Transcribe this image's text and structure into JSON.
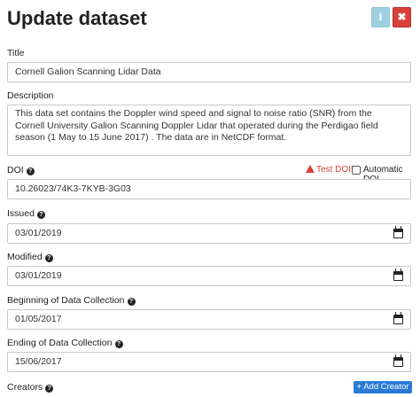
{
  "header": {
    "title": "Update dataset",
    "info_icon": "info-icon",
    "close_icon": "close-icon",
    "info_label": "i",
    "close_label": "✖"
  },
  "form": {
    "title": {
      "label": "Title",
      "value": "Cornell Galion Scanning Lidar Data"
    },
    "description": {
      "label": "Description",
      "value": "This data set contains the Doppler wind speed and signal to noise ratio (SNR) from the Cornell University Galion Scanning Doppler Lidar that operated during the Perdigao field season (1 May to 15 June 2017) . The data are in NetCDF format."
    },
    "doi": {
      "label": "DOI",
      "value": "10.26023/74K3-7KYB-3G03",
      "test_doi": "Test DOI!",
      "automatic_doi": "Automatic DOI",
      "automatic_checked": false
    },
    "issued": {
      "label": "Issued",
      "value": "03/01/2019"
    },
    "modified": {
      "label": "Modified",
      "value": "03/01/2019"
    },
    "begin_collection": {
      "label": "Beginning of Data Collection",
      "value": "01/05/2017"
    },
    "end_collection": {
      "label": "Ending of Data Collection",
      "value": "15/06/2017"
    },
    "creators": {
      "label": "Creators",
      "add_button": "+ Add Creator"
    },
    "help_glyph": "?"
  },
  "colors": {
    "danger": "#d9403a",
    "info": "#9fd0e0",
    "primary": "#2a7bd6"
  }
}
